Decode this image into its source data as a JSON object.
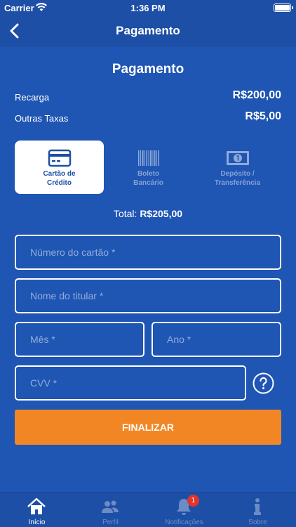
{
  "status_bar": {
    "carrier": "Carrier",
    "time": "1:36 PM"
  },
  "nav": {
    "title": "Pagamento",
    "back_icon": "chevron-left-icon"
  },
  "page": {
    "heading": "Pagamento"
  },
  "summary": {
    "recharge_label": "Recarga",
    "recharge_value": "R$200,00",
    "fees_label": "Outras Taxas",
    "fees_value": "R$5,00"
  },
  "payment_methods": [
    {
      "label": "Cartão de\nCrédito",
      "icon": "credit-card-icon",
      "selected": true
    },
    {
      "label": "Boleto\nBancário",
      "icon": "barcode-icon",
      "selected": false
    },
    {
      "label": "Depósito /\nTransferência",
      "icon": "banknote-icon",
      "selected": false
    }
  ],
  "total": {
    "label": "Total:",
    "value": "R$205,00"
  },
  "form": {
    "card_number_placeholder": "Número do cartão *",
    "holder_name_placeholder": "Nome do titular *",
    "month_placeholder": "Mês *",
    "year_placeholder": "Ano *",
    "cvv_placeholder": "CVV *",
    "help_icon": "question-circle-icon",
    "submit_label": "FINALIZAR"
  },
  "tabs": [
    {
      "label": "Início",
      "icon": "home-icon",
      "active": true
    },
    {
      "label": "Perfil",
      "icon": "people-icon",
      "active": false
    },
    {
      "label": "Notificações",
      "icon": "bell-icon",
      "active": false,
      "badge": "1"
    },
    {
      "label": "Sobre",
      "icon": "info-icon",
      "active": false
    }
  ],
  "colors": {
    "background": "#1f55b3",
    "bar": "#1d4fa6",
    "accent": "#f28625",
    "badge": "#e0352b"
  }
}
